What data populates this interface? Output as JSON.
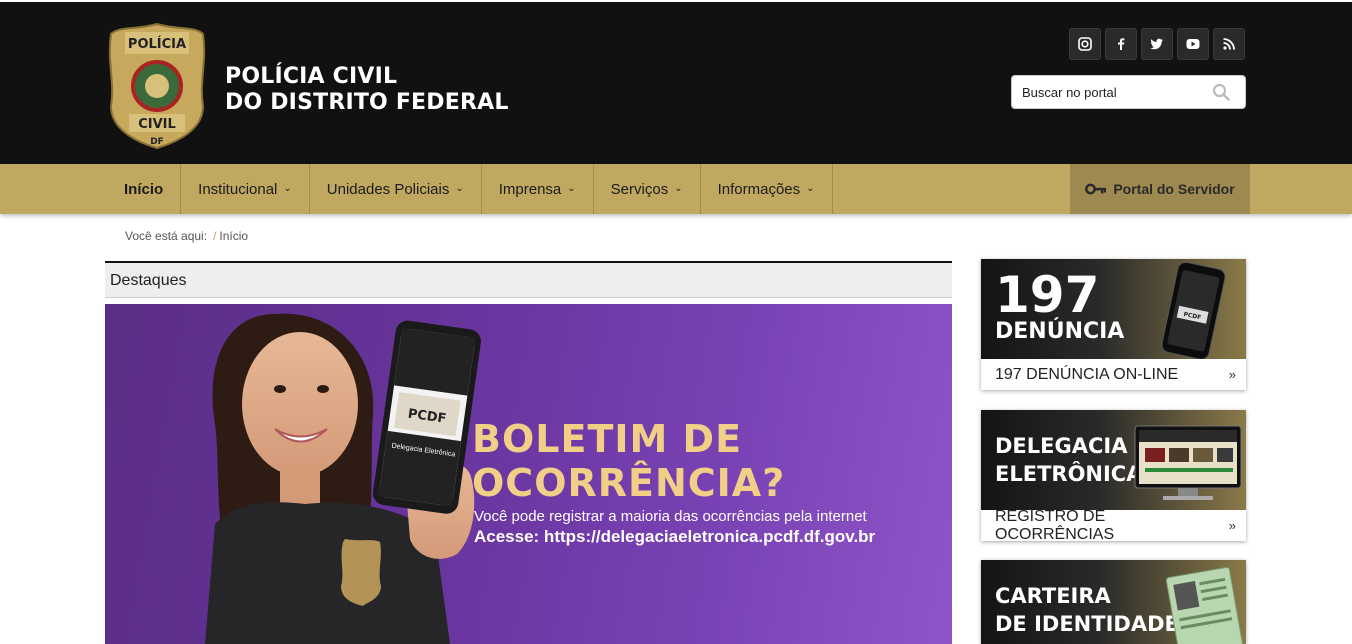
{
  "header": {
    "title_line1": "POLÍCIA CIVIL",
    "title_line2": "DO DISTRITO FEDERAL",
    "badge_top": "POLÍCIA",
    "badge_bottom": "CIVIL",
    "badge_df": "DF",
    "social": [
      {
        "icon": "instagram-icon",
        "glyph": "◙"
      },
      {
        "icon": "facebook-icon",
        "glyph": "f"
      },
      {
        "icon": "twitter-icon",
        "glyph": "🐦"
      },
      {
        "icon": "youtube-icon",
        "glyph": "▶"
      },
      {
        "icon": "rss-icon",
        "glyph": "◔"
      }
    ],
    "search_placeholder": "Buscar no portal"
  },
  "nav": {
    "items": [
      {
        "label": "Início",
        "dropdown": false
      },
      {
        "label": "Institucional",
        "dropdown": true
      },
      {
        "label": "Unidades Policiais",
        "dropdown": true
      },
      {
        "label": "Imprensa",
        "dropdown": true
      },
      {
        "label": "Serviços",
        "dropdown": true
      },
      {
        "label": "Informações",
        "dropdown": true
      }
    ],
    "portal_label": "Portal do Servidor"
  },
  "breadcrumb": {
    "prefix": "Você está aqui:",
    "current": "Início"
  },
  "destaques": {
    "heading": "Destaques",
    "banner": {
      "title_line1": "BOLETIM DE",
      "title_line2": "OCORRÊNCIA?",
      "subtitle": "Você pode registrar a maioria das ocorrências pela internet",
      "url_line": "Acesse: https://delegaciaeletronica.pcdf.df.gov.br",
      "phone_screen_title": "Delegacia Eletrônica",
      "phone_logo": "PCDF"
    }
  },
  "sidebar": {
    "cards": [
      {
        "big1": "197",
        "big2": "DENÚNCIA",
        "label": "197 DENÚNCIA ON-LINE"
      },
      {
        "big1": "DELEGACIA",
        "big2": "ELETRÔNICA",
        "label": "REGISTRO DE OCORRÊNCIAS"
      },
      {
        "big1": "CARTEIRA",
        "big2": "DE IDENTIDADE",
        "label": ""
      }
    ]
  },
  "colors": {
    "header_bg": "#111111",
    "nav_gold": "#c0a860",
    "portal_bg": "#9e8950",
    "banner_purple": "#6a36a0",
    "banner_title": "#f2cf86"
  }
}
